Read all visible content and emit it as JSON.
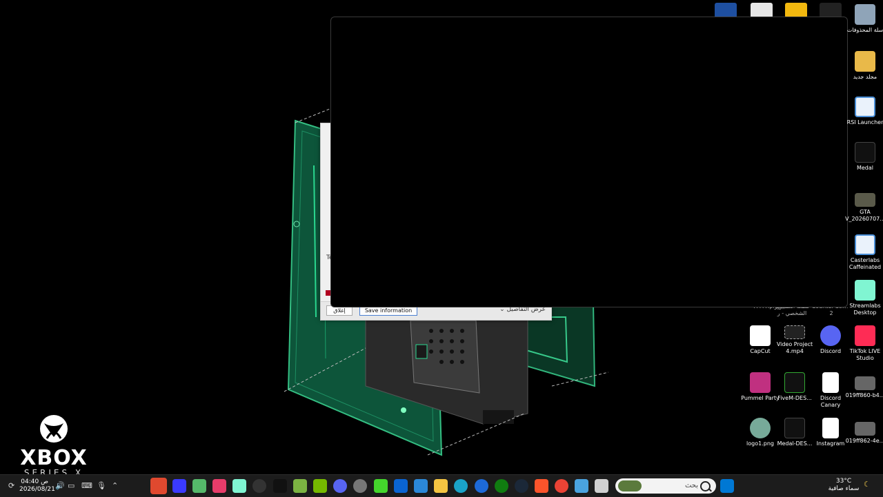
{
  "wallpaper": {
    "brand": "XBOX",
    "subtitle": "SERIES X"
  },
  "dialog": {
    "partial_text": "Te",
    "close_label": "إغلاق",
    "save_label": "Save information",
    "details_label": "عرض التفاصيل"
  },
  "desktop_icons": [
    {
      "name": "recycle-bin",
      "label": "سلة المحذوفات",
      "color": "#9ab"
    },
    {
      "name": "new-folder",
      "label": "مجلد جديد",
      "color": "#e9b949"
    },
    {
      "name": "rsi-launcher",
      "label": "RSI Launcher",
      "color": "#eaf2fb"
    },
    {
      "name": "medal",
      "label": "Medal",
      "color": "#111"
    },
    {
      "name": "gta-v-screenshot",
      "label": "GTA V_20260707...",
      "color": "#5a5a4a"
    },
    {
      "name": "casterlabs-caffeinated",
      "label": "Casterlabs Caffeinated",
      "color": "#eaf2fb"
    },
    {
      "name": "streamlabs-desktop",
      "label": "Streamlabs Desktop",
      "color": "#80f5d2"
    },
    {
      "name": "capcut",
      "label": "CapCut",
      "color": "#fff"
    },
    {
      "name": "video-project",
      "label": "Video Project 4.mp4",
      "color": "#222"
    },
    {
      "name": "discord",
      "label": "Discord",
      "color": "#5865f2"
    },
    {
      "name": "tiktok-live-studio",
      "label": "TikTok LIVE Studio",
      "color": "#fe2c55"
    },
    {
      "name": "pummel-party",
      "label": "Pummel Party",
      "color": "#c03080"
    },
    {
      "name": "fivem",
      "label": "FiveM-DES...",
      "color": "#111"
    },
    {
      "name": "discord-canary",
      "label": "Discord Canary",
      "color": "#fff"
    },
    {
      "name": "video-019ff860",
      "label": "019ff860-b4...",
      "color": "#666"
    },
    {
      "name": "logo1",
      "label": "logo1.png",
      "color": "#7a9"
    },
    {
      "name": "medal-des",
      "label": "Medal-DES...",
      "color": "#111"
    },
    {
      "name": "instagram",
      "label": "Instagram",
      "color": "#fff"
    },
    {
      "name": "video-019ff862",
      "label": "019ff862-4e...",
      "color": "#666"
    }
  ],
  "behind_labels": {
    "a": "?????.png",
    "b": "Counter-Str...",
    "c": "قطعة الكمبيوتر الشخصي - ر",
    "d": "2"
  },
  "taskbar": {
    "time": "04:40 ص",
    "date": "2026/08/21",
    "search_placeholder": "بحث",
    "temperature": "33°C",
    "weather_text": "سماء صافية",
    "apps": [
      "app-close-red",
      "vpn-app",
      "nvidia-broadcast",
      "tiktok",
      "streamlabs",
      "obs",
      "medal",
      "bluestacks",
      "nvidia",
      "discord",
      "settings",
      "razer-cortex",
      "outlook",
      "microsoft-store",
      "file-explorer",
      "edge",
      "ea-app",
      "xbox",
      "steam",
      "brave",
      "chrome",
      "remote-desktop",
      "taskbar-generic"
    ]
  }
}
